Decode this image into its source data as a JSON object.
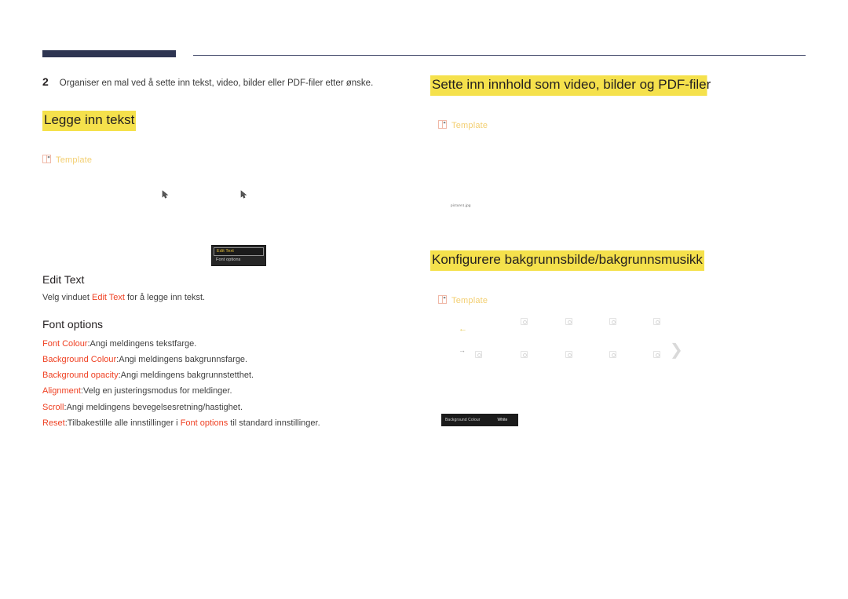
{
  "page": {
    "language": "Norwegian",
    "accent_color": "#ef4123",
    "highlight_color": "#f5e14c",
    "rule_color": "#2e3552",
    "template_label_color": "#f3cf72"
  },
  "step": {
    "number": "2",
    "text": "Organiser en mal ved å sette inn tekst, video, bilder eller PDF-filer etter ønske."
  },
  "sections": {
    "insert_text": {
      "heading": "Legge inn tekst",
      "template_label": "Template",
      "template_icon": "template-icon",
      "context_menu": {
        "items": [
          {
            "label": "Edit Text",
            "selected": true
          },
          {
            "label": "Font options",
            "selected": false
          }
        ]
      },
      "edit_text": {
        "title": "Edit Text",
        "desc_before": "Velg vinduet ",
        "desc_accent": "Edit Text",
        "desc_after": " for å legge inn tekst."
      },
      "font_options": {
        "title": "Font options",
        "items": [
          {
            "term": "Font Colour",
            "desc": ":Angi meldingens tekstfarge."
          },
          {
            "term": "Background Colour",
            "desc": ":Angi meldingens bakgrunnsfarge."
          },
          {
            "term": "Background opacity",
            "desc": ":Angi meldingens bakgrunnstetthet."
          },
          {
            "term": "Alignment",
            "desc": ":Velg en justeringsmodus for meldinger."
          },
          {
            "term": "Scroll",
            "desc": ":Angi meldingens bevegelsesretning/hastighet."
          },
          {
            "term": "Reset",
            "desc_before": ":Tilbakestille alle innstillinger i ",
            "desc_accent": "Font options",
            "desc_after": " til standard innstillinger."
          }
        ]
      }
    },
    "insert_content": {
      "heading": "Sette inn innhold som video, bilder og PDF-filer",
      "template_label": "Template",
      "template_icon": "template-icon",
      "filename": "picture1.jpg"
    },
    "configure_background": {
      "heading": "Konfigurere bakgrunnsbilde/bakgrunnsmusikk",
      "template_label": "Template",
      "template_icon": "template-icon",
      "navigation": {
        "prev_arrow": "←",
        "next_arrow": "→",
        "page_chevron": "❯"
      },
      "setting_bar": {
        "label": "Background Colour",
        "value": "White"
      }
    }
  }
}
